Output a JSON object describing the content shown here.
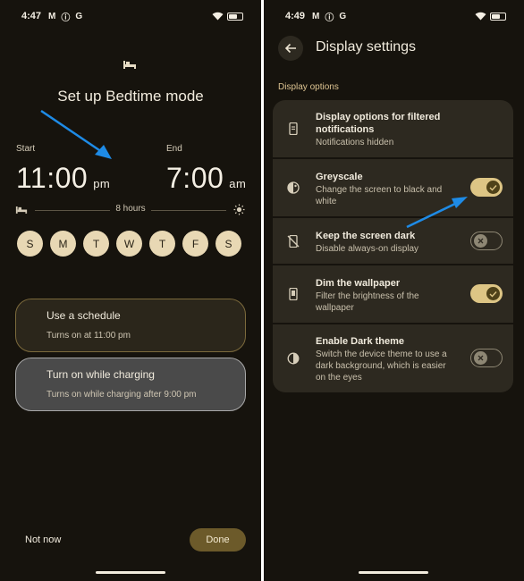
{
  "left": {
    "status": {
      "time": "4:47",
      "icons": [
        "gmail-icon",
        "info-icon",
        "google-icon"
      ]
    },
    "title": "Set up Bedtime mode",
    "start": {
      "label": "Start",
      "time": "11:00",
      "ampm": "pm"
    },
    "end": {
      "label": "End",
      "time": "7:00",
      "ampm": "am"
    },
    "duration": "8 hours",
    "days": [
      "S",
      "M",
      "T",
      "W",
      "T",
      "F",
      "S"
    ],
    "options": [
      {
        "title": "Use a schedule",
        "subtitle": "Turns on at 11:00 pm"
      },
      {
        "title": "Turn on while charging",
        "subtitle": "Turns on while charging after 9:00 pm"
      }
    ],
    "not_now": "Not now",
    "done": "Done"
  },
  "right": {
    "status": {
      "time": "4:49",
      "icons": [
        "gmail-icon",
        "info-icon",
        "google-icon"
      ]
    },
    "title": "Display settings",
    "section": "Display options",
    "settings": [
      {
        "title": "Display options for filtered notifications",
        "subtitle": "Notifications hidden",
        "icon": "phone-notification-icon"
      },
      {
        "title": "Greyscale",
        "subtitle": "Change the screen to black and white",
        "icon": "greyscale-icon",
        "toggle": true
      },
      {
        "title": "Keep the screen dark",
        "subtitle": "Disable always-on display",
        "icon": "screen-off-icon",
        "toggle": false
      },
      {
        "title": "Dim the wallpaper",
        "subtitle": "Filter the brightness of the wallpaper",
        "icon": "wallpaper-dim-icon",
        "toggle": true
      },
      {
        "title": "Enable Dark theme",
        "subtitle": "Switch the device theme to use a dark background, which is easier on the eyes",
        "icon": "dark-theme-icon",
        "toggle": false
      }
    ]
  },
  "colors": {
    "background": "#16130d",
    "card": "#2d2920",
    "accent": "#ddc585",
    "annotation_arrow": "#1e8be6"
  }
}
